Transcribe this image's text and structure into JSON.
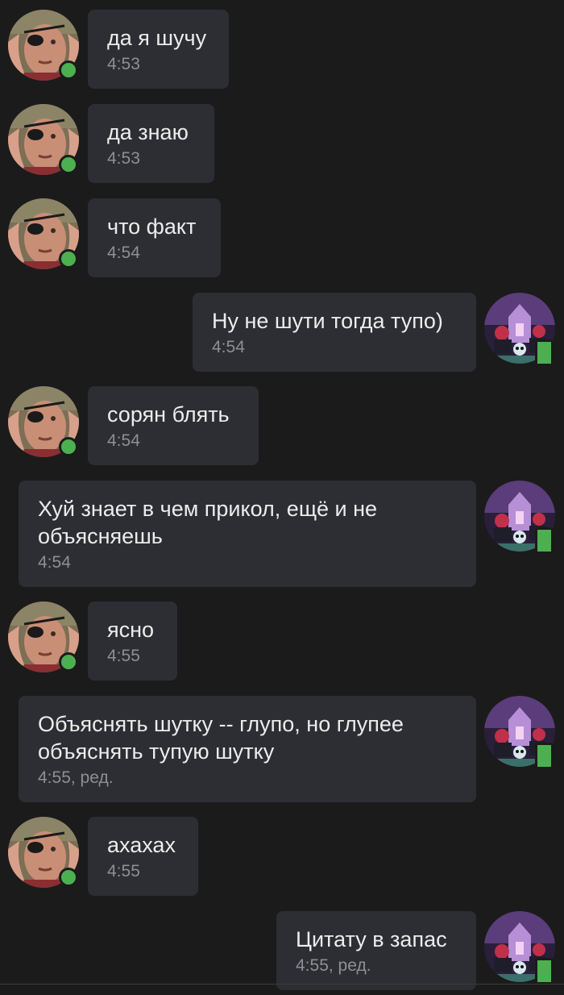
{
  "messages": [
    {
      "side": "in",
      "text": "да я шучу",
      "time": "4:53"
    },
    {
      "side": "in",
      "text": "да знаю",
      "time": "4:53"
    },
    {
      "side": "in",
      "text": "что факт",
      "time": "4:54"
    },
    {
      "side": "out",
      "text": "Ну не шути тогда тупо)",
      "time": "4:54"
    },
    {
      "side": "in",
      "text": "сорян блять",
      "time": "4:54"
    },
    {
      "side": "out",
      "text": "Хуй знает в чем прикол, ещё и не\nобъясняешь",
      "time": "4:54"
    },
    {
      "side": "in",
      "text": "ясно",
      "time": "4:55"
    },
    {
      "side": "out",
      "text": "Объяснять шутку -- глупо, но глупее\nобъяснять тупую шутку",
      "time": "4:55, ред."
    },
    {
      "side": "in",
      "text": "ахахах",
      "time": "4:55"
    },
    {
      "side": "out",
      "text": "Цитату в запас",
      "time": "4:55, ред."
    }
  ],
  "colors": {
    "background": "#1b1b1b",
    "bubble": "#2d2e33",
    "text": "#ececec",
    "time": "#8d8f95",
    "online": "#4cb050"
  },
  "icons": {
    "incoming_avatar": "user-photo-avatar",
    "outgoing_avatar": "cartoon-art-avatar",
    "online_status": "online-dot-icon",
    "mobile_status": "mobile-online-icon"
  }
}
